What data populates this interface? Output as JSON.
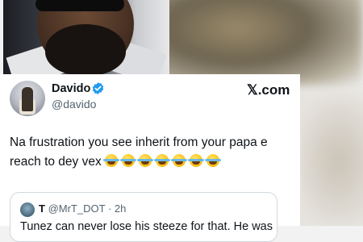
{
  "tweet": {
    "display_name": "Davido",
    "handle": "@davido",
    "source_label": "𝕏.com",
    "text": "Na frustration  you see inherit from your papa e reach to dey vex",
    "emoji_count": 7,
    "emoji_name": "tears-of-joy"
  },
  "quoted": {
    "name": "T",
    "handle": "@MrT_DOT",
    "separator": "·",
    "time": "2h",
    "text": "Tunez can never lose his steeze for that. He was"
  },
  "colors": {
    "verified": "#1d9bf0",
    "text": "#0f1419",
    "muted": "#536471",
    "border": "#cfd9de"
  }
}
